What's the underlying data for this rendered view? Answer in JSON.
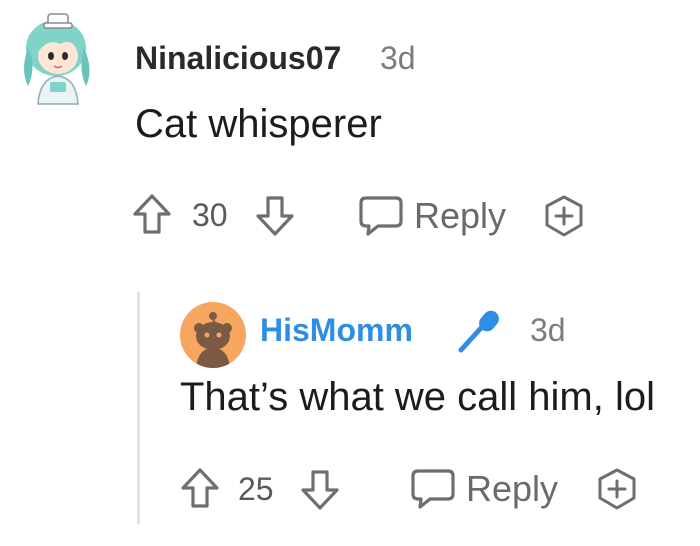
{
  "comment": {
    "username": "Ninalicious07",
    "time": "3d",
    "body": "Cat whisperer",
    "upvotes": "30",
    "reply_label": "Reply"
  },
  "reply": {
    "username": "HisMomm",
    "time": "3d",
    "body": "That’s what we call him, lol",
    "upvotes": "25",
    "reply_label": "Reply"
  },
  "icons": {
    "upvote": "arrow-up-outline-icon",
    "downvote": "arrow-down-outline-icon",
    "reply": "speech-bubble-icon",
    "award": "award-plus-icon",
    "flair": "microphone-icon"
  },
  "colors": {
    "reply_username": "#2f8de4",
    "reply_avatar_bg": "#f6a65e",
    "thread_line": "#e4e4e4"
  }
}
